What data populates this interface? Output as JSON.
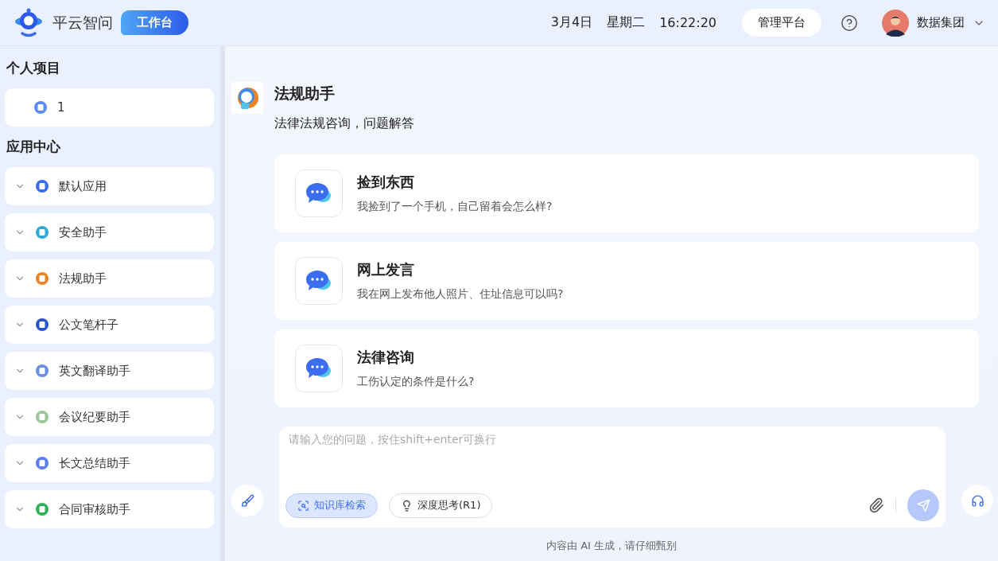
{
  "header": {
    "brand": "平云智问",
    "badge": "工作台",
    "date": "3月4日",
    "weekday": "星期二",
    "time": "16:22:20",
    "admin_button": "管理平台",
    "user": "数据集团"
  },
  "sidebar": {
    "sections": [
      {
        "title": "个人项目",
        "items": [
          {
            "label": "1",
            "expandable": false,
            "color": "#5b8cff"
          }
        ]
      },
      {
        "title": "应用中心",
        "items": [
          {
            "label": "默认应用",
            "expandable": true,
            "color": "#3b6df0"
          },
          {
            "label": "安全助手",
            "expandable": true,
            "color": "#2fa9d6"
          },
          {
            "label": "法规助手",
            "expandable": true,
            "color": "#e8832a"
          },
          {
            "label": "公文笔杆子",
            "expandable": true,
            "color": "#2a55c8"
          },
          {
            "label": "英文翻译助手",
            "expandable": true,
            "color": "#6a8fe0"
          },
          {
            "label": "会议纪要助手",
            "expandable": true,
            "color": "#9bc79a"
          },
          {
            "label": "长文总结助手",
            "expandable": true,
            "color": "#5b7ff0"
          },
          {
            "label": "合同审核助手",
            "expandable": true,
            "color": "#2fb35a"
          }
        ]
      }
    ]
  },
  "agent": {
    "name": "法规助手",
    "description": "法律法规咨询，问题解答"
  },
  "suggestions": [
    {
      "title": "捡到东西",
      "question": "我捡到了一个手机，自己留着会怎么样?"
    },
    {
      "title": "网上发言",
      "question": "我在网上发布他人照片、住址信息可以吗?"
    },
    {
      "title": "法律咨询",
      "question": "工伤认定的条件是什么?"
    }
  ],
  "composer": {
    "placeholder": "请输入您的问题，按住shift+enter可换行",
    "toggles": [
      {
        "label": "知识库检索",
        "selected": true,
        "kind": "search"
      },
      {
        "label": "深度思考(R1)",
        "selected": false,
        "kind": "think"
      }
    ]
  },
  "footer": "内容由 AI 生成，请仔细甄别"
}
